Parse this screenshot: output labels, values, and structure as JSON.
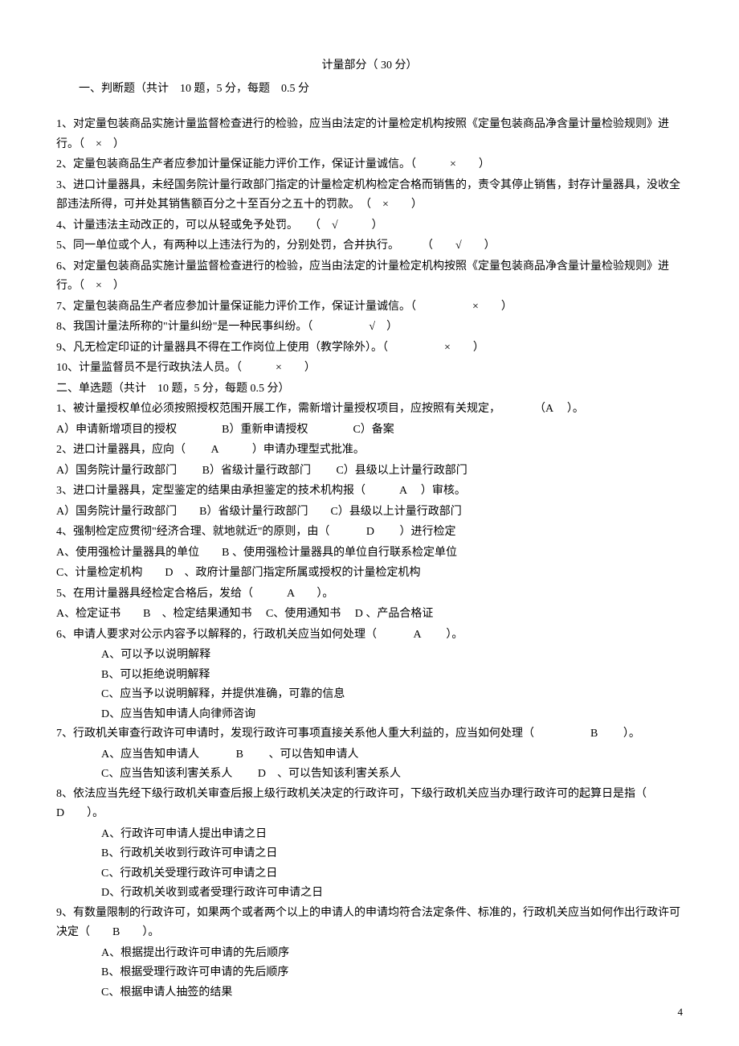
{
  "header": {
    "title": "计量部分（  30 分）"
  },
  "section1": {
    "intro": "一、判断题（共计　10 题，5 分，每题　0.5 分",
    "q1": "1、对定量包装商品实施计量监督检查进行的检验，应当由法定的计量检定机构按照《定量包装商品净含量计量检验规则》进行。（　×　）",
    "q2": "2、定量包装商品生产者应参加计量保证能力评价工作，保证计量诚信。（　　　×　　）",
    "q3": "3、进口计量器具，未经国务院计量行政部门指定的计量检定机构检定合格而销售的，责令其停止销售，封存计量器具，没收全部违法所得，可并处其销售额百分之十至百分之五十的罚款。　（　×　　）",
    "q4": "4、计量违法主动改正的，可以从轻或免予处罚。　　（　√　　　）",
    "q5": "5、同一单位或个人，有两种以上违法行为的，分别处罚，合并执行。　　　（　　√　　）",
    "q6": "6、对定量包装商品实施计量监督检查进行的检验，应当由法定的计量检定机构按照《定量包装商品净含量计量检验规则》进行。（　×　）",
    "q7": "7、定量包装商品生产者应参加计量保证能力评价工作，保证计量诚信。（　　　　　×　　）",
    "q8": "8、我国计量法所称的\"计量纠纷\"是一种民事纠纷。（　　　　　√　）",
    "q9": "9、凡无检定印证的计量器具不得在工作岗位上使用（教学除外）。（　　　　　×　　）",
    "q10": "10、计量监督员不是行政执法人员。（　　　×　　）"
  },
  "section2": {
    "intro": "二、单选题（共计　10 题，5 分，每题  0.5 分）",
    "q1": "1、被计量授权单位必须按照授权范围开展工作，需新增计量授权项目，应按照有关规定，　　　　（A　  ）。",
    "q1_opts": "A）申请新增项目的授权　　　　B）重新申请授权　　　　C）备案",
    "q2": "2、进口计量器具，应向（　　 A　　　）申请办理型式批准。",
    "q2_opts": "A）国务院计量行政部门　　 B）省级计量行政部门　　 C）县级以上计量行政部门",
    "q3": "3、进口计量器具，定型鉴定的结果由承担鉴定的技术机构报（　　　A　 ）审核。",
    "q3_opts": "A）国务院计量行政部门　　B）省级计量行政部门　　C）县级以上计量行政部门",
    "q4": "4、强制检定应贯彻\"经济合理、就地就近\"的原则，由（　　　 D　　 ）进行检定",
    "q4_opts_a": "A、使用强检计量器具的单位　　B 、使用强检计量器具的单位自行联系检定单位",
    "q4_opts_b": "C、计量检定机构　　D　、政府计量部门指定所属或授权的计量检定机构",
    "q5": "5、在用计量器具经检定合格后，发给（　　　A　　）。",
    "q5_opts": "A、检定证书　　B　、检定结果通知书　 C、使用通知书　 D  、产品合格证",
    "q6": "6、申请人要求对公示内容予以解释的，行政机关应当如何处理（　　　 A　　 ）。",
    "q6_a": "A、可以予以说明解释",
    "q6_b": "B、可以拒绝说明解释",
    "q6_c": "C、应当予以说明解释，并提供准确，可靠的信息",
    "q6_d": "D、应当告知申请人向律师咨询",
    "q7": "7、行政机关审查行政许可申请时，发现行政许可事项直接关系他人重大利益的，应当如何处理（　　　　　B　　 ）。",
    "q7_ab": "A、应当告知申请人　　　  B　　 、可以告知申请人",
    "q7_cd": "C、应当告知该利害关系人　　  D　、可以告知该利害关系人",
    "q8": "8、依法应当先经下级行政机关审查后报上级行政机关决定的行政许可，下级行政机关应当办理行政许可的起算日是指（　D　　）。",
    "q8_a": "A、行政许可申请人提出申请之日",
    "q8_b": "B、行政机关收到行政许可申请之日",
    "q8_c": "C、行政机关受理行政许可申请之日",
    "q8_d": "D、行政机关收到或者受理行政许可申请之日",
    "q9": "9、有数量限制的行政许可，如果两个或者两个以上的申请人的申请均符合法定条件、标准的，行政机关应当如何作出行政许可决定（　　B　　）。",
    "q9_a": "A、根据提出行政许可申请的先后顺序",
    "q9_b": "B、根据受理行政许可申请的先后顺序",
    "q9_c": "C、根据申请人抽签的结果"
  },
  "pageNumber": "4"
}
